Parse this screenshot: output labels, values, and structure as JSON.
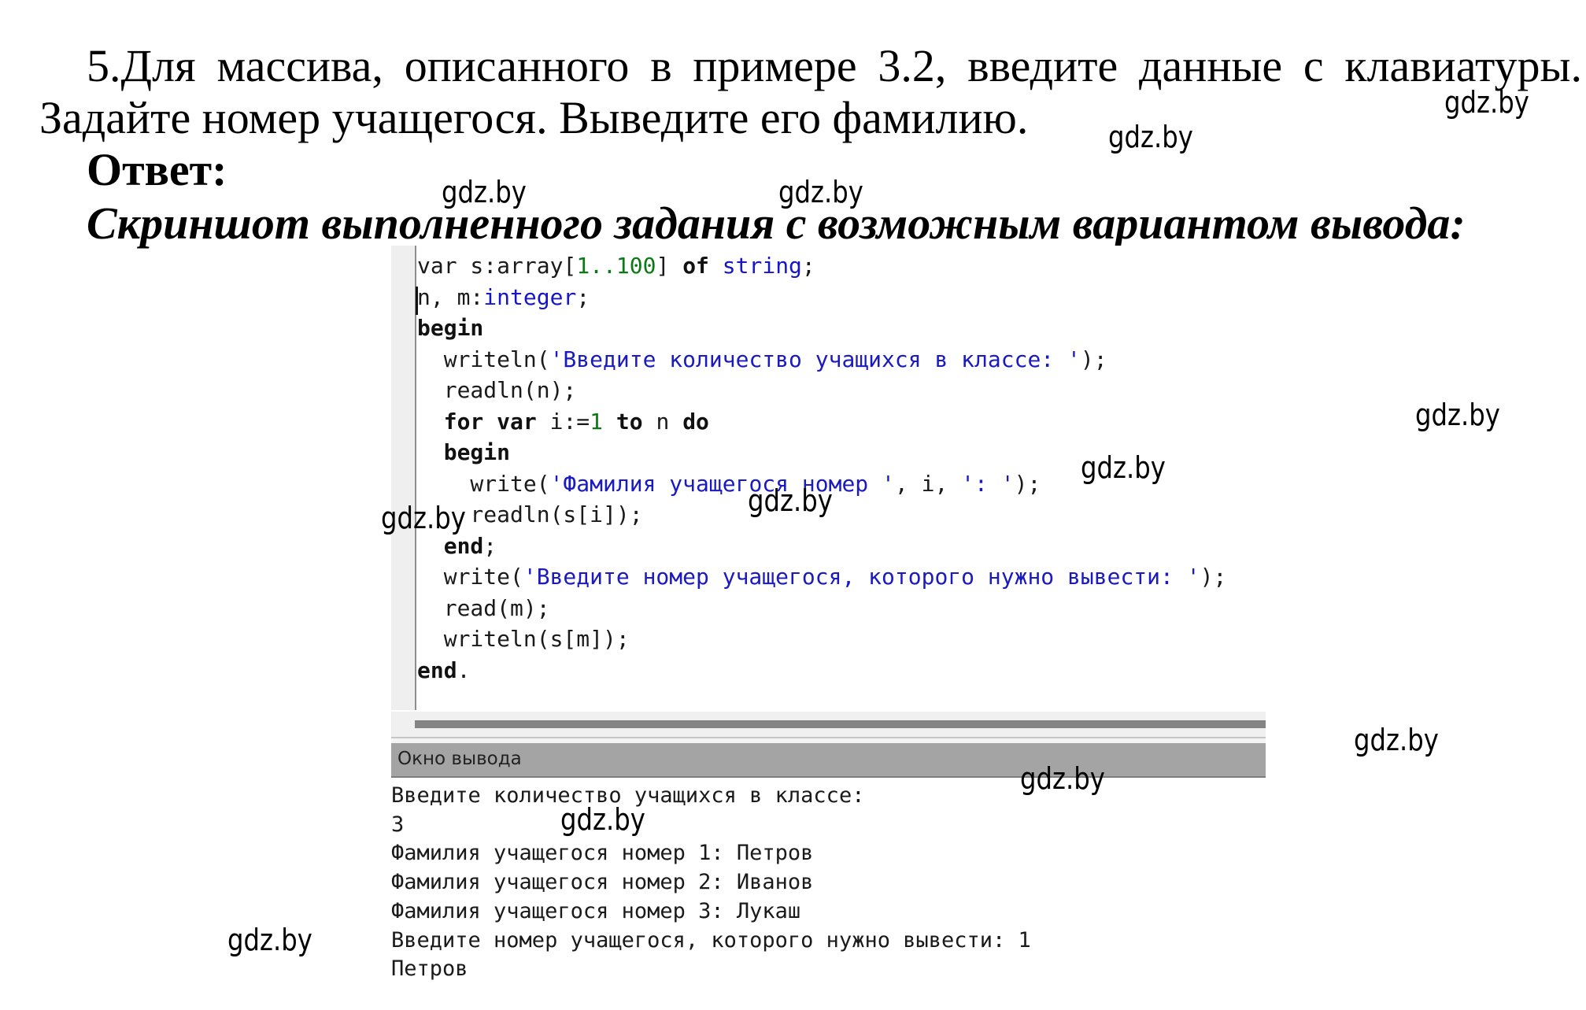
{
  "task": {
    "line1": "5.Для массива, описанного в примере 3.2, введите данные с клавиатуры.",
    "line2": "Задайте номер учащегося. Выведите его фамилию.",
    "answer_label": "Ответ:",
    "caption": "Скриншот выполненного задания с возможным вариантом вывода:"
  },
  "editor": {
    "lines": [
      [
        {
          "t": "var",
          "c": "plain"
        },
        {
          "t": " s:",
          "c": "plain"
        },
        {
          "t": "array",
          "c": "plain"
        },
        {
          "t": "[",
          "c": "plain"
        },
        {
          "t": "1..100",
          "c": "num"
        },
        {
          "t": "] ",
          "c": "plain"
        },
        {
          "t": "of",
          "c": "kw"
        },
        {
          "t": " ",
          "c": "plain"
        },
        {
          "t": "string",
          "c": "type"
        },
        {
          "t": ";",
          "c": "plain"
        }
      ],
      [
        {
          "t": "n, m:",
          "c": "plain"
        },
        {
          "t": "integer",
          "c": "type"
        },
        {
          "t": ";",
          "c": "plain"
        }
      ],
      [
        {
          "t": "begin",
          "c": "kw"
        }
      ],
      [
        {
          "t": "  writeln(",
          "c": "plain"
        },
        {
          "t": "'Введите количество учащихся в классе: '",
          "c": "str"
        },
        {
          "t": ");",
          "c": "plain"
        }
      ],
      [
        {
          "t": "  readln(n);",
          "c": "plain"
        }
      ],
      [
        {
          "t": "  ",
          "c": "plain"
        },
        {
          "t": "for",
          "c": "kw"
        },
        {
          "t": " ",
          "c": "plain"
        },
        {
          "t": "var",
          "c": "kw"
        },
        {
          "t": " i:=",
          "c": "plain"
        },
        {
          "t": "1",
          "c": "num"
        },
        {
          "t": " ",
          "c": "plain"
        },
        {
          "t": "to",
          "c": "kw"
        },
        {
          "t": " n ",
          "c": "plain"
        },
        {
          "t": "do",
          "c": "kw"
        }
      ],
      [
        {
          "t": "  ",
          "c": "plain"
        },
        {
          "t": "begin",
          "c": "kw"
        }
      ],
      [
        {
          "t": "    write(",
          "c": "plain"
        },
        {
          "t": "'Фамилия учащегося номер '",
          "c": "str"
        },
        {
          "t": ", i, ",
          "c": "plain"
        },
        {
          "t": "': '",
          "c": "str"
        },
        {
          "t": ");",
          "c": "plain"
        }
      ],
      [
        {
          "t": "    readln(s[i]);",
          "c": "plain"
        }
      ],
      [
        {
          "t": "  ",
          "c": "plain"
        },
        {
          "t": "end",
          "c": "kw"
        },
        {
          "t": ";",
          "c": "plain"
        }
      ],
      [
        {
          "t": "  write(",
          "c": "plain"
        },
        {
          "t": "'Введите номер учащегося, которого нужно вывести: '",
          "c": "str"
        },
        {
          "t": ");",
          "c": "plain"
        }
      ],
      [
        {
          "t": "  read(m);",
          "c": "plain"
        }
      ],
      [
        {
          "t": "  writeln(s[m]);",
          "c": "plain"
        }
      ],
      [
        {
          "t": "end",
          "c": "kw"
        },
        {
          "t": ".",
          "c": "plain"
        }
      ]
    ]
  },
  "output_window": {
    "title": "Окно вывода",
    "lines": [
      "Введите количество учащихся в классе:",
      "3",
      "Фамилия учащегося номер 1: Петров",
      "Фамилия учащегося номер 2: Иванов",
      "Фамилия учащегося номер 3: Лукаш",
      "Введите номер учащегося, которого нужно вывести: 1",
      "Петров"
    ]
  },
  "watermarks": [
    "gdz.by",
    "gdz.by",
    "gdz.by",
    "gdz.by",
    "gdz.by",
    "gdz.by",
    "gdz.by",
    "gdz.by",
    "gdz.by",
    "gdz.by",
    "gdz.by",
    "gdz.by"
  ],
  "colors": {
    "keyword": "#111111",
    "number": "#0a7a14",
    "type": "#1616c8",
    "string": "#1a1ac0",
    "output_header_bg": "#a4a4a4",
    "gutter_bg": "#efefef"
  }
}
